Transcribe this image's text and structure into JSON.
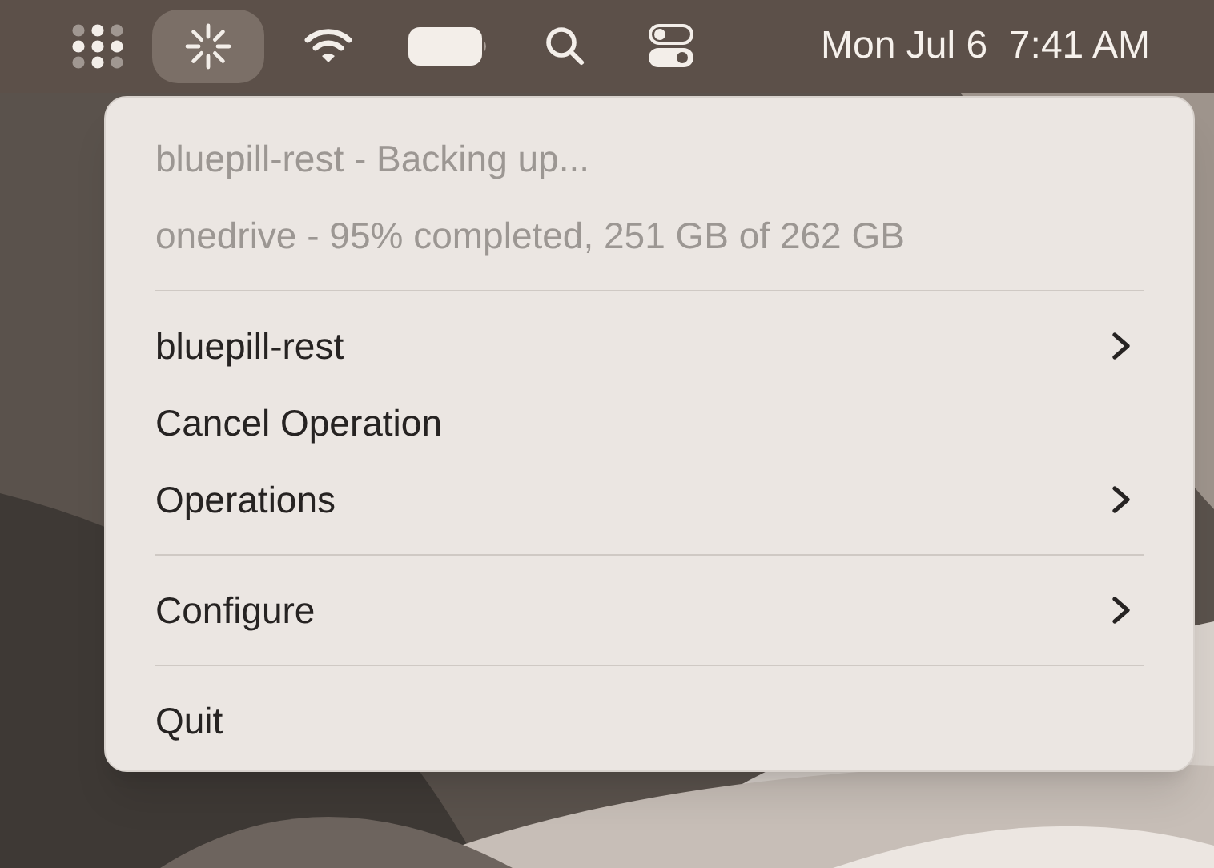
{
  "menu_bar": {
    "status_items": [
      {
        "kind": "apps",
        "selected": false
      },
      {
        "kind": "spinner",
        "selected": true
      },
      {
        "kind": "wifi",
        "selected": false
      },
      {
        "kind": "battery",
        "selected": false
      },
      {
        "kind": "search",
        "selected": false
      },
      {
        "kind": "controls",
        "selected": false
      }
    ],
    "clock": "Mon Jul 6  7:41 AM"
  },
  "menu": {
    "sections": [
      [
        {
          "label": "bluepill-rest - Backing up...",
          "disabled": true,
          "submenu": false
        },
        {
          "label": "onedrive - 95% completed, 251 GB of 262 GB",
          "disabled": true,
          "submenu": false
        }
      ],
      [
        {
          "label": "bluepill-rest",
          "disabled": false,
          "submenu": true
        },
        {
          "label": "Cancel Operation",
          "disabled": false,
          "submenu": false
        },
        {
          "label": "Operations",
          "disabled": false,
          "submenu": true
        }
      ],
      [
        {
          "label": "Configure",
          "disabled": false,
          "submenu": true
        }
      ],
      [
        {
          "label": "Quit",
          "disabled": false,
          "submenu": false
        }
      ]
    ]
  }
}
